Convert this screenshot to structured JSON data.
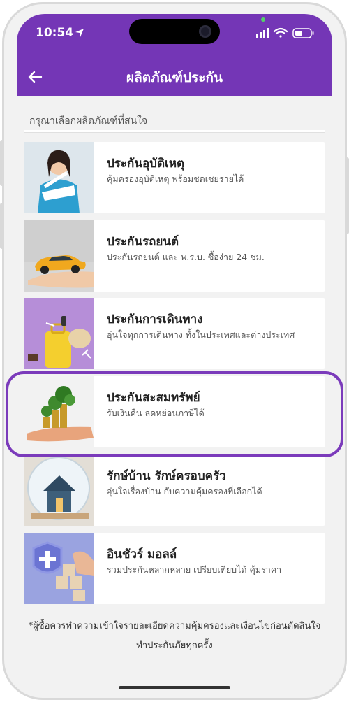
{
  "status_bar": {
    "time": "10:54"
  },
  "header": {
    "title": "ผลิตภัณฑ์ประกัน"
  },
  "prompt": "กรุณาเลือกผลิตภัณฑ์ที่สนใจ",
  "products": [
    {
      "title": "ประกันอุบัติเหตุ",
      "subtitle": "คุ้มครองอุบัติเหตุ พร้อมชดเชยรายได้"
    },
    {
      "title": "ประกันรถยนต์",
      "subtitle": "ประกันรถยนต์ และ พ.ร.บ. ซื้อง่าย 24 ชม."
    },
    {
      "title": "ประกันการเดินทาง",
      "subtitle": "อุ่นใจทุกการเดินทาง ทั้งในประเทศและต่างประเทศ"
    },
    {
      "title": "ประกันสะสมทรัพย์",
      "subtitle": "รับเงินคืน ลดหย่อนภาษีได้"
    },
    {
      "title": "รักษ์บ้าน รักษ์ครอบครัว",
      "subtitle": "อุ่นใจเรื่องบ้าน กับความคุ้มครองที่เลือกได้"
    },
    {
      "title": "อินชัวร์ มอลล์",
      "subtitle": "รวมประกันหลากหลาย เปรียบเทียบได้ คุ้มราคา"
    }
  ],
  "disclaimer": "*ผู้ซื้อควรทำความเข้าใจรายละเอียดความคุ้มครองและเงื่อนไขก่อนตัดสินใจทำประกันภัยทุกครั้ง",
  "colors": {
    "header": "#7436b6",
    "highlight": "#7b3bbb",
    "background": "#f2f2f2"
  },
  "icons": [
    "location-arrow-icon",
    "signal-icon",
    "wifi-icon",
    "battery-icon",
    "back-arrow-icon"
  ]
}
